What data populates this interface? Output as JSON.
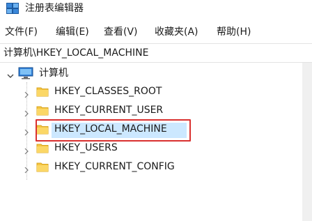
{
  "window": {
    "title": "注册表编辑器"
  },
  "menu": {
    "items": [
      {
        "label": "文件(F)"
      },
      {
        "label": "编辑(E)"
      },
      {
        "label": "查看(V)"
      },
      {
        "label": "收藏夹(A)"
      },
      {
        "label": "帮助(H)"
      }
    ]
  },
  "address": {
    "path": "计算机\\HKEY_LOCAL_MACHINE"
  },
  "tree": {
    "root_label": "计算机",
    "items": [
      {
        "label": "HKEY_CLASSES_ROOT"
      },
      {
        "label": "HKEY_CURRENT_USER"
      },
      {
        "label": "HKEY_LOCAL_MACHINE",
        "selected": true
      },
      {
        "label": "HKEY_USERS"
      },
      {
        "label": "HKEY_CURRENT_CONFIG"
      }
    ]
  },
  "colors": {
    "selection": "#cce8ff",
    "highlight_border": "#d9302f",
    "folder": "#f5c542"
  },
  "icons": {
    "app": "registry-editor-icon",
    "root": "computer-icon",
    "expand": "chevron-down-icon",
    "collapse": "chevron-right-icon",
    "key": "folder-icon"
  }
}
